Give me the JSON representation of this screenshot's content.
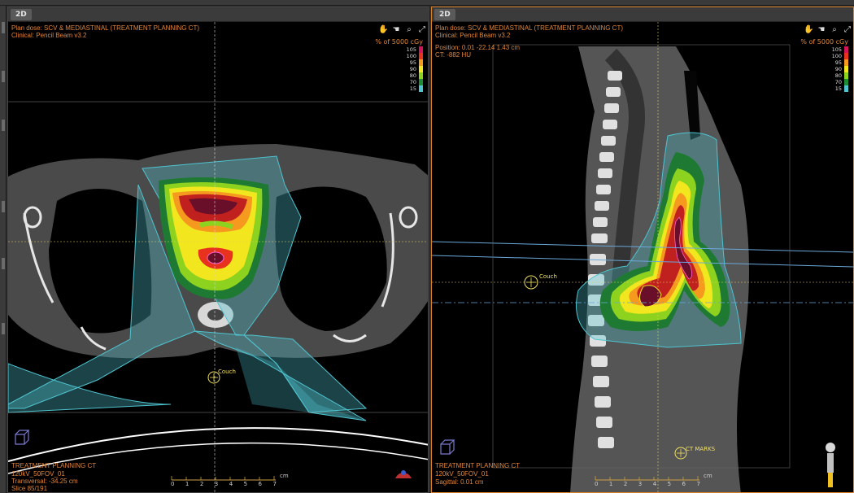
{
  "left_view": {
    "tab": "2D",
    "plan_line": "Plan dose: SCV & MEDIASTINAL (TREATMENT PLANNING CT)",
    "clinical_line": "Clinical: Pencil Beam v3.2",
    "legend_title": "% of 5000 cGy",
    "couch_label": "Couch",
    "series_name": "TREATMENT PLANNING CT",
    "scan_params": "120kV_50FOV_01",
    "plane_position": "Transversal: -34.25 cm",
    "slice_info": "Slice 85/191"
  },
  "right_view": {
    "tab": "2D",
    "plan_line": "Plan dose: SCV & MEDIASTINAL (TREATMENT PLANNING CT)",
    "clinical_line": "Clinical: Pencil Beam v3.2",
    "position_line": "Position: 0.01 -22.14 1.43 cm",
    "ct_value_line": "CT: -882 HU",
    "legend_title": "% of 5000 cGy",
    "couch_label": "Couch",
    "marks_label": "CT MARKS",
    "series_name": "TREATMENT PLANNING CT",
    "scan_params": "120kV_50FOV_01",
    "plane_position": "Sagittal: 0.01 cm"
  },
  "legend_levels": [
    {
      "label": "105",
      "color": "#d2145a"
    },
    {
      "label": "100",
      "color": "#e8321e"
    },
    {
      "label": "95",
      "color": "#f59a1e"
    },
    {
      "label": "90",
      "color": "#f2e61e"
    },
    {
      "label": "80",
      "color": "#8cd21e"
    },
    {
      "label": "70",
      "color": "#1e8c32"
    },
    {
      "label": "15",
      "color": "#4fc3cf"
    }
  ],
  "scale": {
    "numbers": [
      "0",
      "1",
      "2",
      "3",
      "4",
      "5",
      "6",
      "7"
    ],
    "unit": "cm"
  },
  "tool_icons": [
    "hand-pan-icon",
    "hand-grab-icon",
    "zoom-icon",
    "fit-screen-icon"
  ]
}
